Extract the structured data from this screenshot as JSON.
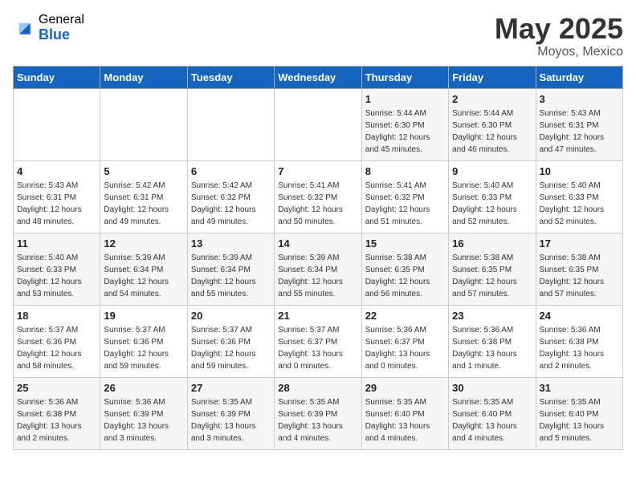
{
  "logo": {
    "general": "General",
    "blue": "Blue"
  },
  "header": {
    "month": "May 2025",
    "location": "Moyos, Mexico"
  },
  "weekdays": [
    "Sunday",
    "Monday",
    "Tuesday",
    "Wednesday",
    "Thursday",
    "Friday",
    "Saturday"
  ],
  "weeks": [
    [
      {
        "day": null
      },
      {
        "day": null
      },
      {
        "day": null
      },
      {
        "day": null
      },
      {
        "day": 1,
        "sunrise": "5:44 AM",
        "sunset": "6:30 PM",
        "daylight": "12 hours and 45 minutes."
      },
      {
        "day": 2,
        "sunrise": "5:44 AM",
        "sunset": "6:30 PM",
        "daylight": "12 hours and 46 minutes."
      },
      {
        "day": 3,
        "sunrise": "5:43 AM",
        "sunset": "6:31 PM",
        "daylight": "12 hours and 47 minutes."
      }
    ],
    [
      {
        "day": 4,
        "sunrise": "5:43 AM",
        "sunset": "6:31 PM",
        "daylight": "12 hours and 48 minutes."
      },
      {
        "day": 5,
        "sunrise": "5:42 AM",
        "sunset": "6:31 PM",
        "daylight": "12 hours and 49 minutes."
      },
      {
        "day": 6,
        "sunrise": "5:42 AM",
        "sunset": "6:32 PM",
        "daylight": "12 hours and 49 minutes."
      },
      {
        "day": 7,
        "sunrise": "5:41 AM",
        "sunset": "6:32 PM",
        "daylight": "12 hours and 50 minutes."
      },
      {
        "day": 8,
        "sunrise": "5:41 AM",
        "sunset": "6:32 PM",
        "daylight": "12 hours and 51 minutes."
      },
      {
        "day": 9,
        "sunrise": "5:40 AM",
        "sunset": "6:33 PM",
        "daylight": "12 hours and 52 minutes."
      },
      {
        "day": 10,
        "sunrise": "5:40 AM",
        "sunset": "6:33 PM",
        "daylight": "12 hours and 52 minutes."
      }
    ],
    [
      {
        "day": 11,
        "sunrise": "5:40 AM",
        "sunset": "6:33 PM",
        "daylight": "12 hours and 53 minutes."
      },
      {
        "day": 12,
        "sunrise": "5:39 AM",
        "sunset": "6:34 PM",
        "daylight": "12 hours and 54 minutes."
      },
      {
        "day": 13,
        "sunrise": "5:39 AM",
        "sunset": "6:34 PM",
        "daylight": "12 hours and 55 minutes."
      },
      {
        "day": 14,
        "sunrise": "5:39 AM",
        "sunset": "6:34 PM",
        "daylight": "12 hours and 55 minutes."
      },
      {
        "day": 15,
        "sunrise": "5:38 AM",
        "sunset": "6:35 PM",
        "daylight": "12 hours and 56 minutes."
      },
      {
        "day": 16,
        "sunrise": "5:38 AM",
        "sunset": "6:35 PM",
        "daylight": "12 hours and 57 minutes."
      },
      {
        "day": 17,
        "sunrise": "5:38 AM",
        "sunset": "6:35 PM",
        "daylight": "12 hours and 57 minutes."
      }
    ],
    [
      {
        "day": 18,
        "sunrise": "5:37 AM",
        "sunset": "6:36 PM",
        "daylight": "12 hours and 58 minutes."
      },
      {
        "day": 19,
        "sunrise": "5:37 AM",
        "sunset": "6:36 PM",
        "daylight": "12 hours and 59 minutes."
      },
      {
        "day": 20,
        "sunrise": "5:37 AM",
        "sunset": "6:36 PM",
        "daylight": "12 hours and 59 minutes."
      },
      {
        "day": 21,
        "sunrise": "5:37 AM",
        "sunset": "6:37 PM",
        "daylight": "13 hours and 0 minutes."
      },
      {
        "day": 22,
        "sunrise": "5:36 AM",
        "sunset": "6:37 PM",
        "daylight": "13 hours and 0 minutes."
      },
      {
        "day": 23,
        "sunrise": "5:36 AM",
        "sunset": "6:38 PM",
        "daylight": "13 hours and 1 minute."
      },
      {
        "day": 24,
        "sunrise": "5:36 AM",
        "sunset": "6:38 PM",
        "daylight": "13 hours and 2 minutes."
      }
    ],
    [
      {
        "day": 25,
        "sunrise": "5:36 AM",
        "sunset": "6:38 PM",
        "daylight": "13 hours and 2 minutes."
      },
      {
        "day": 26,
        "sunrise": "5:36 AM",
        "sunset": "6:39 PM",
        "daylight": "13 hours and 3 minutes."
      },
      {
        "day": 27,
        "sunrise": "5:35 AM",
        "sunset": "6:39 PM",
        "daylight": "13 hours and 3 minutes."
      },
      {
        "day": 28,
        "sunrise": "5:35 AM",
        "sunset": "6:39 PM",
        "daylight": "13 hours and 4 minutes."
      },
      {
        "day": 29,
        "sunrise": "5:35 AM",
        "sunset": "6:40 PM",
        "daylight": "13 hours and 4 minutes."
      },
      {
        "day": 30,
        "sunrise": "5:35 AM",
        "sunset": "6:40 PM",
        "daylight": "13 hours and 4 minutes."
      },
      {
        "day": 31,
        "sunrise": "5:35 AM",
        "sunset": "6:40 PM",
        "daylight": "13 hours and 5 minutes."
      }
    ]
  ]
}
